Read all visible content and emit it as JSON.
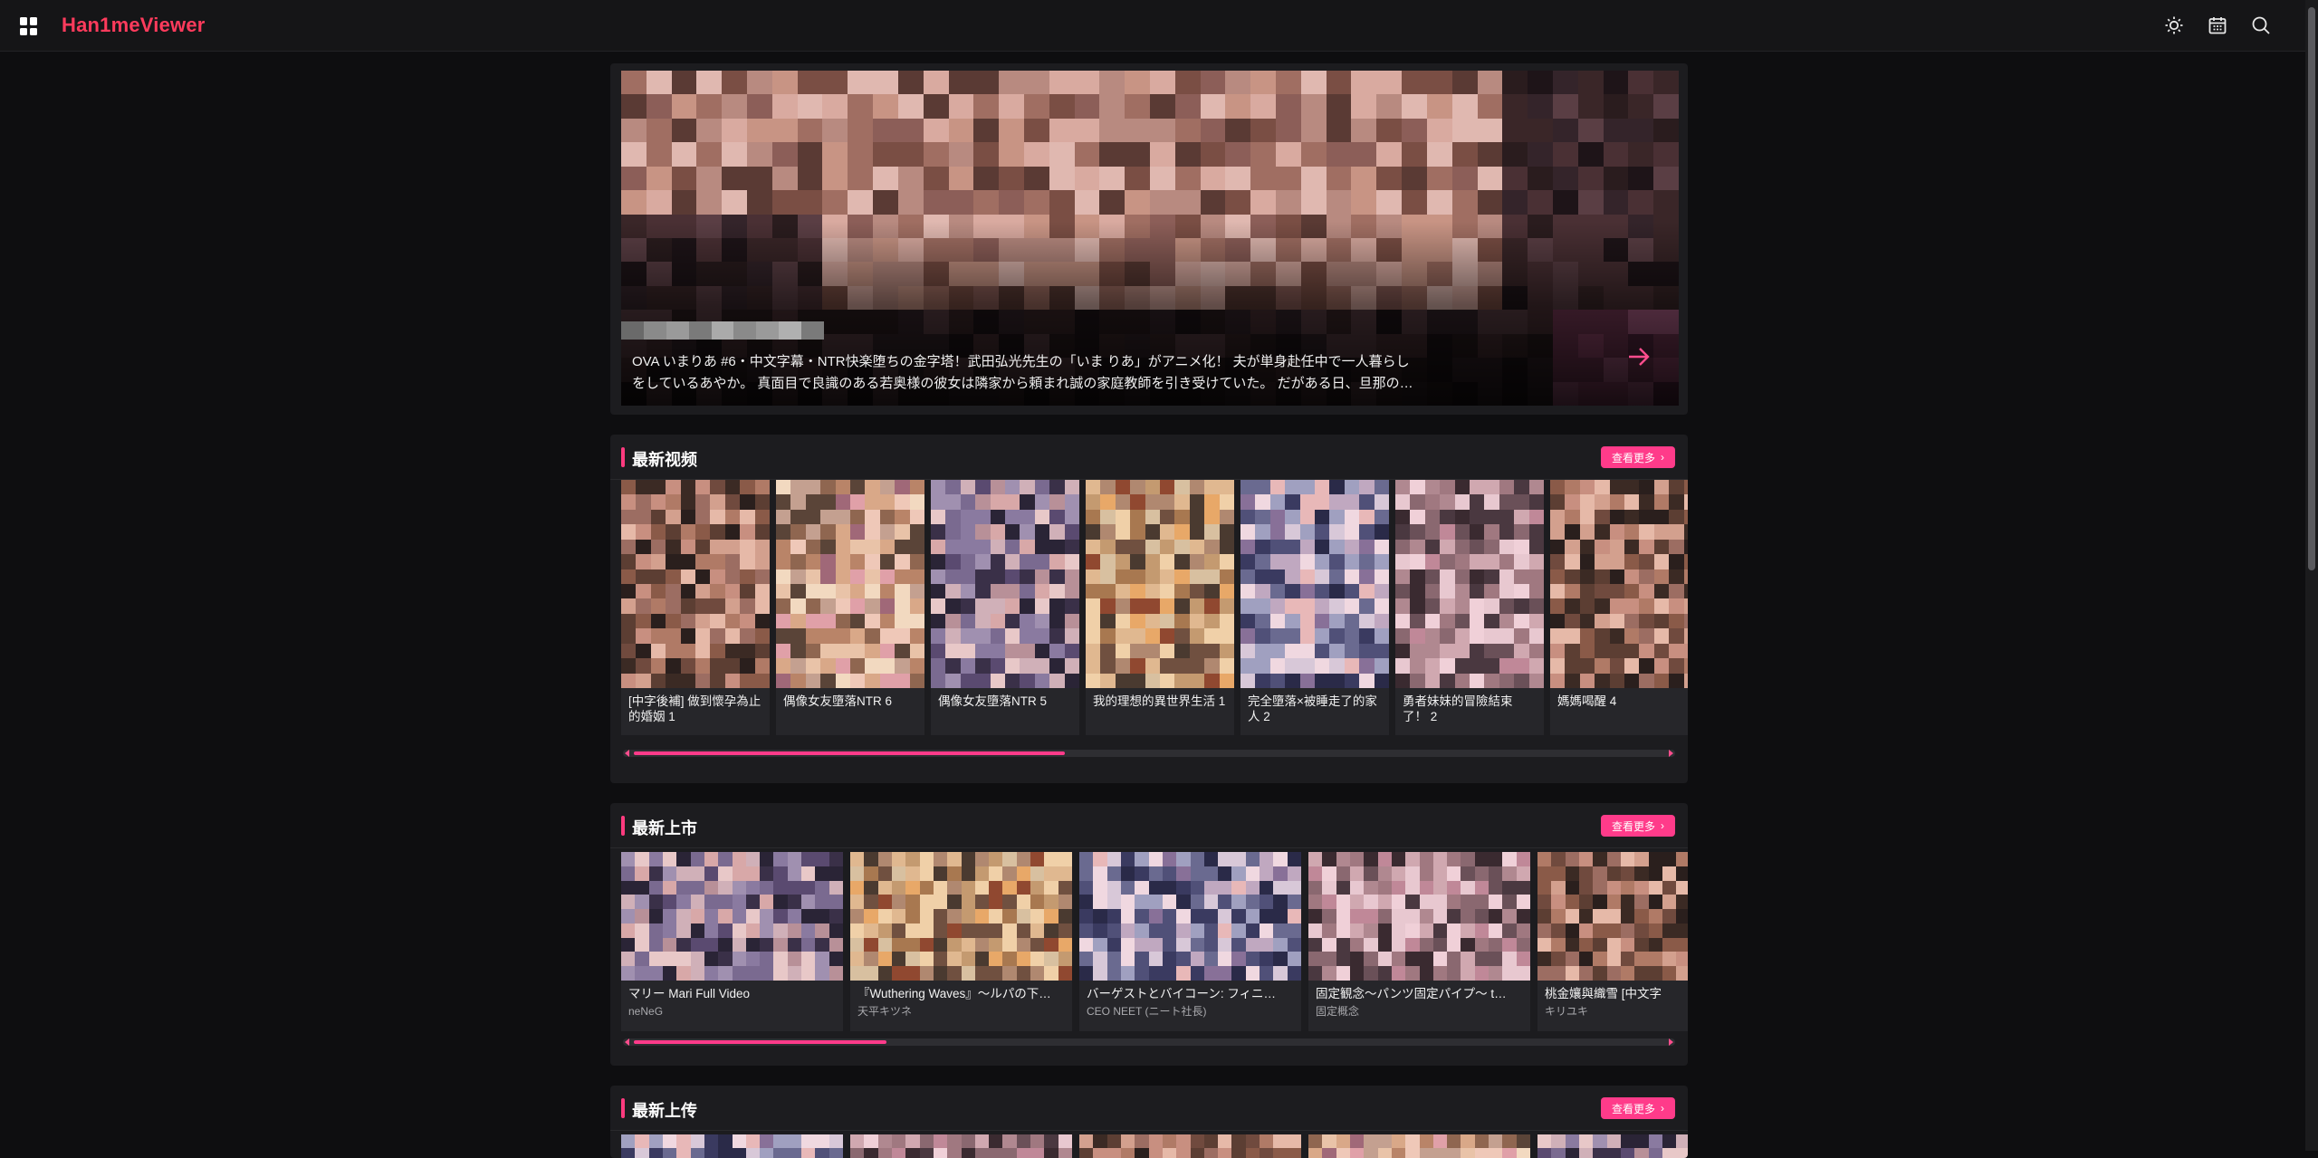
{
  "app": {
    "brand": "Han1meViewer"
  },
  "topbar_icons": [
    "apps-grid-icon",
    "sun-icon",
    "calendar-icon",
    "search-icon"
  ],
  "colors": {
    "accent": "#ff3b8a",
    "brand": "#ff3b5c",
    "background": "#0e0e10",
    "panel": "#1c1c1f"
  },
  "hero": {
    "description_line1": "OVA いまりあ #6・中文字幕・NTR快楽堕ちの金字塔！武田弘光先生の「いま りあ」がアニメ化！ 夫が単身赴任中で一人暮らし",
    "description_line2": "をしているあやか。 真面目で良識のある若奥様の彼女は隣家から頼まれ誠の家庭教師を引き受けていた。 だがある日、旦那の…"
  },
  "sections": [
    {
      "title": "最新视频",
      "more_label": "查看更多",
      "scroll_fraction": 0.42,
      "items": [
        {
          "title": "[中字後補] 做到懷孕為止的婚姻 1"
        },
        {
          "title": "偶像女友墮落NTR 6"
        },
        {
          "title": "偶像女友墮落NTR 5"
        },
        {
          "title": "我的理想的異世界生活 1"
        },
        {
          "title": "完全墮落×被睡走了的家人 2"
        },
        {
          "title": "勇者妹妹的冒險結束了！ 2"
        },
        {
          "title": "媽媽喝醒 4"
        }
      ]
    },
    {
      "title": "最新上市",
      "more_label": "查看更多",
      "scroll_fraction": 0.25,
      "items": [
        {
          "title": "マリー Mari Full Video",
          "subtitle": "neNeG"
        },
        {
          "title": "『Wuthering Waves』～ルパの下…",
          "subtitle": "天平キツネ"
        },
        {
          "title": "バーゲストとバイコーン: フィニ…",
          "subtitle": "CEO NEET (ニート社長)"
        },
        {
          "title": "固定観念～パンツ固定パイプ～ t…",
          "subtitle": "固定概念"
        },
        {
          "title": "桃金孃與織雪 [中文字",
          "subtitle": "キリユキ"
        }
      ]
    },
    {
      "title": "最新上传",
      "more_label": "查看更多"
    }
  ]
}
